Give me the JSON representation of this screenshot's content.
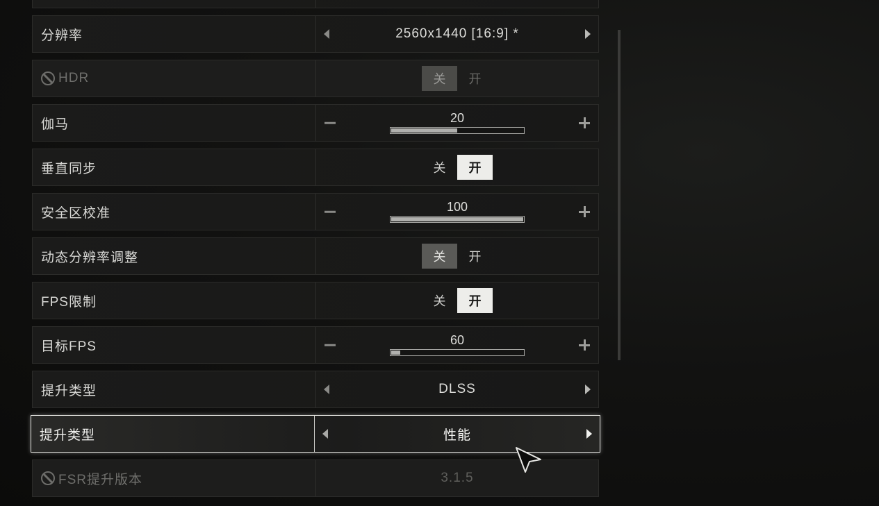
{
  "settings": [
    {
      "type": "partial",
      "label": ""
    },
    {
      "type": "selector",
      "label": "分辨率",
      "value": "2560x1440 [16:9] *"
    },
    {
      "type": "toggle",
      "label": "HDR",
      "disabled": true,
      "off": "关",
      "on": "开",
      "selected": "off"
    },
    {
      "type": "slider",
      "label": "伽马",
      "value": "20",
      "fill": 0.5
    },
    {
      "type": "toggle",
      "label": "垂直同步",
      "off": "关",
      "on": "开",
      "selected": "on"
    },
    {
      "type": "slider",
      "label": "安全区校准",
      "value": "100",
      "fill": 1.0
    },
    {
      "type": "toggle",
      "label": "动态分辨率调整",
      "off": "关",
      "on": "开",
      "selected": "off"
    },
    {
      "type": "toggle",
      "label": "FPS限制",
      "off": "关",
      "on": "开",
      "selected": "on"
    },
    {
      "type": "slider",
      "label": "目标FPS",
      "value": "60",
      "fill": 0.07
    },
    {
      "type": "selector",
      "label": "提升类型",
      "value": "DLSS"
    },
    {
      "type": "selector",
      "label": "提升类型",
      "value": "性能",
      "focused": true
    },
    {
      "type": "static",
      "label": "FSR提升版本",
      "value": "3.1.5",
      "disabled": true
    }
  ],
  "colors": {
    "background": "#121211",
    "row": "#1b1b1a",
    "toggle_active": "#ededea",
    "focus_border": "#e7e7e3"
  },
  "icons": {
    "disabled": "prohibited-icon",
    "left": "arrow-left-icon",
    "right": "arrow-right-icon",
    "cursor": "mouse-pointer-icon"
  }
}
